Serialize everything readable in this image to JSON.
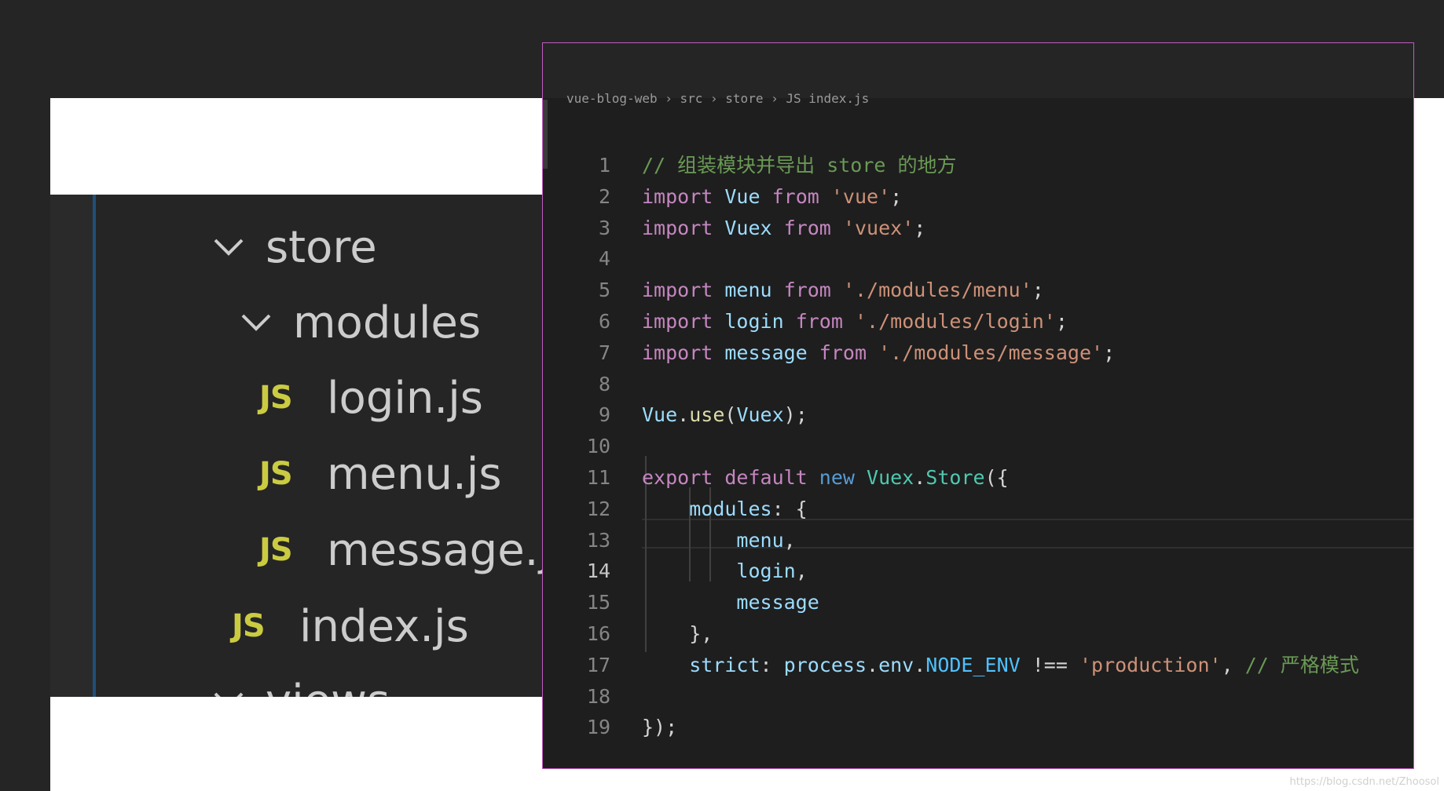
{
  "explorer": {
    "items": [
      {
        "label": "store",
        "kind": "folder"
      },
      {
        "label": "modules",
        "kind": "folder"
      },
      {
        "label": "login.js",
        "kind": "js"
      },
      {
        "label": "menu.js",
        "kind": "js"
      },
      {
        "label": "message.js",
        "kind": "js"
      },
      {
        "label": "index.js",
        "kind": "js"
      },
      {
        "label": "views",
        "kind": "folder"
      }
    ],
    "js_badge": "JS"
  },
  "editor": {
    "breadcrumb": "vue-blog-web › src › store › JS index.js",
    "active_line": 14,
    "lines": [
      {
        "n": "1",
        "tokens": [
          [
            "comment",
            "// 组装模块并导出 store 的地方"
          ]
        ]
      },
      {
        "n": "2",
        "tokens": [
          [
            "kw",
            "import"
          ],
          [
            "punc",
            " "
          ],
          [
            "var",
            "Vue"
          ],
          [
            "punc",
            " "
          ],
          [
            "kw",
            "from"
          ],
          [
            "punc",
            " "
          ],
          [
            "str",
            "'vue'"
          ],
          [
            "punc",
            ";"
          ]
        ]
      },
      {
        "n": "3",
        "tokens": [
          [
            "kw",
            "import"
          ],
          [
            "punc",
            " "
          ],
          [
            "var",
            "Vuex"
          ],
          [
            "punc",
            " "
          ],
          [
            "kw",
            "from"
          ],
          [
            "punc",
            " "
          ],
          [
            "str",
            "'vuex'"
          ],
          [
            "punc",
            ";"
          ]
        ]
      },
      {
        "n": "4",
        "tokens": []
      },
      {
        "n": "5",
        "tokens": [
          [
            "kw",
            "import"
          ],
          [
            "punc",
            " "
          ],
          [
            "var",
            "menu"
          ],
          [
            "punc",
            " "
          ],
          [
            "kw",
            "from"
          ],
          [
            "punc",
            " "
          ],
          [
            "str",
            "'./modules/menu'"
          ],
          [
            "punc",
            ";"
          ]
        ]
      },
      {
        "n": "6",
        "tokens": [
          [
            "kw",
            "import"
          ],
          [
            "punc",
            " "
          ],
          [
            "var",
            "login"
          ],
          [
            "punc",
            " "
          ],
          [
            "kw",
            "from"
          ],
          [
            "punc",
            " "
          ],
          [
            "str",
            "'./modules/login'"
          ],
          [
            "punc",
            ";"
          ]
        ]
      },
      {
        "n": "7",
        "tokens": [
          [
            "kw",
            "import"
          ],
          [
            "punc",
            " "
          ],
          [
            "var",
            "message"
          ],
          [
            "punc",
            " "
          ],
          [
            "kw",
            "from"
          ],
          [
            "punc",
            " "
          ],
          [
            "str",
            "'./modules/message'"
          ],
          [
            "punc",
            ";"
          ]
        ]
      },
      {
        "n": "8",
        "tokens": []
      },
      {
        "n": "9",
        "tokens": [
          [
            "var",
            "Vue"
          ],
          [
            "punc",
            "."
          ],
          [
            "fn",
            "use"
          ],
          [
            "punc",
            "("
          ],
          [
            "var",
            "Vuex"
          ],
          [
            "punc",
            ");"
          ]
        ]
      },
      {
        "n": "10",
        "tokens": []
      },
      {
        "n": "11",
        "tokens": [
          [
            "kw",
            "export"
          ],
          [
            "punc",
            " "
          ],
          [
            "kw",
            "default"
          ],
          [
            "punc",
            " "
          ],
          [
            "blue",
            "new"
          ],
          [
            "punc",
            " "
          ],
          [
            "type",
            "Vuex"
          ],
          [
            "punc",
            "."
          ],
          [
            "type",
            "Store"
          ],
          [
            "punc",
            "({"
          ]
        ]
      },
      {
        "n": "12",
        "tokens": [
          [
            "punc",
            "    "
          ],
          [
            "var",
            "modules"
          ],
          [
            "punc",
            ": {"
          ]
        ]
      },
      {
        "n": "13",
        "tokens": [
          [
            "punc",
            "        "
          ],
          [
            "var",
            "menu"
          ],
          [
            "punc",
            ","
          ]
        ]
      },
      {
        "n": "14",
        "tokens": [
          [
            "punc",
            "        "
          ],
          [
            "var",
            "login"
          ],
          [
            "punc",
            ","
          ]
        ]
      },
      {
        "n": "15",
        "tokens": [
          [
            "punc",
            "        "
          ],
          [
            "var",
            "message"
          ]
        ]
      },
      {
        "n": "16",
        "tokens": [
          [
            "punc",
            "    },"
          ]
        ]
      },
      {
        "n": "17",
        "tokens": [
          [
            "punc",
            "    "
          ],
          [
            "var",
            "strict"
          ],
          [
            "punc",
            ": "
          ],
          [
            "var",
            "process"
          ],
          [
            "punc",
            "."
          ],
          [
            "var",
            "env"
          ],
          [
            "punc",
            "."
          ],
          [
            "const",
            "NODE_ENV"
          ],
          [
            "punc",
            " !== "
          ],
          [
            "str",
            "'production'"
          ],
          [
            "punc",
            ", "
          ],
          [
            "comment",
            "// 严格模式"
          ]
        ]
      },
      {
        "n": "18",
        "tokens": []
      },
      {
        "n": "19",
        "tokens": [
          [
            "punc",
            "});"
          ]
        ]
      }
    ]
  },
  "watermark": "https://blog.csdn.net/Zhoosol",
  "colors": {
    "comment": "#6a9955",
    "keyword": "#c586c0",
    "variable": "#9cdcfe",
    "string": "#ce9178",
    "function": "#dcdcaa",
    "type": "#4ec9b0",
    "js_badge": "#cbcb41",
    "editor_border": "#c05bc0"
  },
  "icons": {
    "folder_expanded": "chevron-down-icon",
    "js_file": "js-file-icon"
  }
}
